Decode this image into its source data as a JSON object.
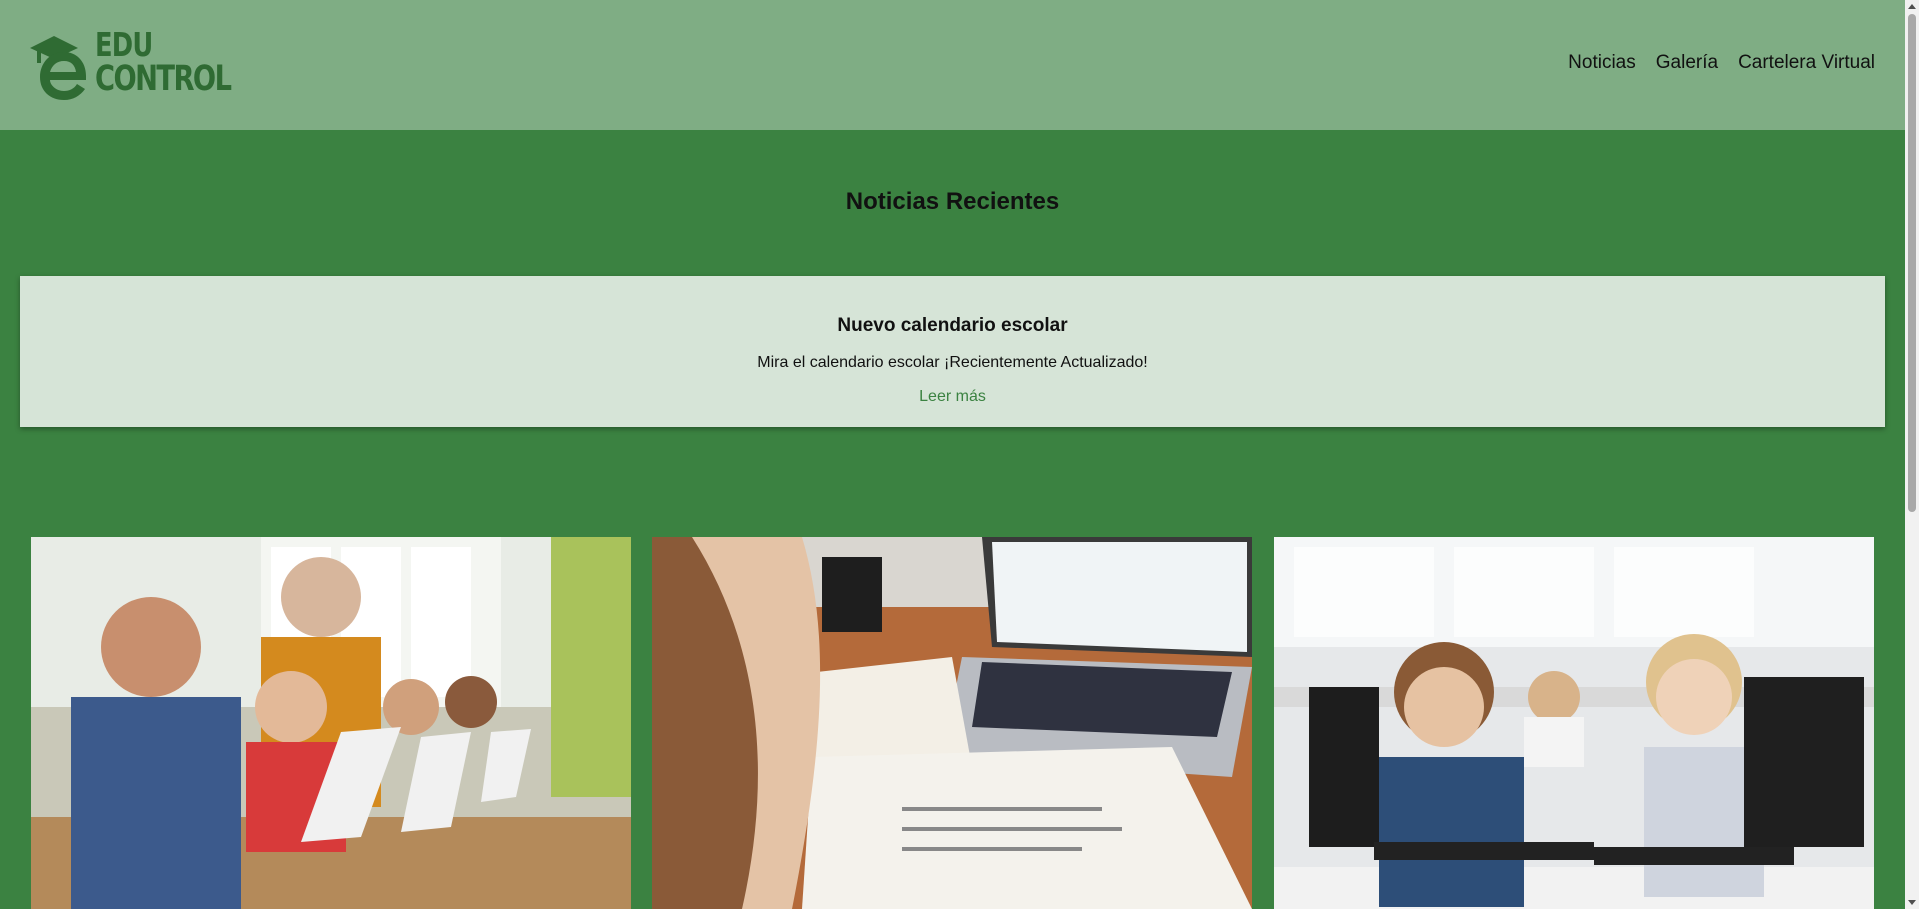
{
  "header": {
    "logo": {
      "line1": "EDU",
      "line2": "CONTROL",
      "brand_color": "#2f6b33"
    },
    "nav": [
      {
        "label": "Noticias"
      },
      {
        "label": "Galería"
      },
      {
        "label": "Cartelera Virtual"
      }
    ]
  },
  "main": {
    "section_title": "Noticias Recientes",
    "news": {
      "title": "Nuevo calendario escolar",
      "text": "Mira el calendario escolar ¡Recientemente Actualizado!",
      "link": "Leer más"
    }
  },
  "colors": {
    "header_bg": "#7fad84",
    "page_bg": "#3b8241",
    "card_bg": "#d6e4d7",
    "link": "#3b8241"
  }
}
